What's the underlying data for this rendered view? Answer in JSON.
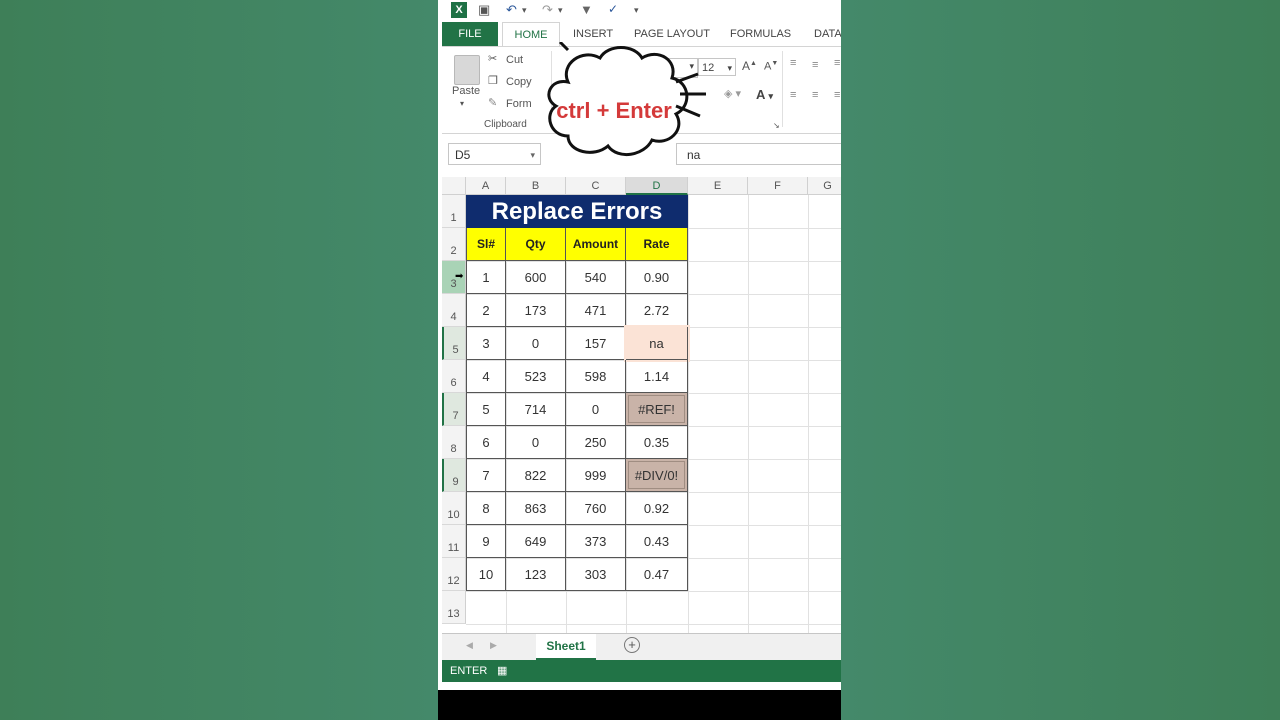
{
  "qat": {
    "undo": "↶",
    "redo": "↷"
  },
  "tabs": [
    "FILE",
    "HOME",
    "INSERT",
    "PAGE LAYOUT",
    "FORMULAS",
    "DATA"
  ],
  "clipboard": {
    "paste": "Paste",
    "cut": "Cut",
    "copy": "Copy",
    "format": "Form",
    "group": "Clipboard"
  },
  "font": {
    "size": "12"
  },
  "callout": "ctrl + Enter",
  "formula": {
    "namebox": "D5",
    "value": "na"
  },
  "columns": [
    "A",
    "B",
    "C",
    "D",
    "E",
    "F",
    "G"
  ],
  "rows": [
    "1",
    "2",
    "3",
    "4",
    "5",
    "6",
    "7",
    "8",
    "9",
    "10",
    "11",
    "12",
    "13"
  ],
  "table": {
    "title": "Replace Errors",
    "headers": [
      "Sl#",
      "Qty",
      "Amount",
      "Rate"
    ],
    "data": [
      [
        "1",
        "600",
        "540",
        "0.90"
      ],
      [
        "2",
        "173",
        "471",
        "2.72"
      ],
      [
        "3",
        "0",
        "157",
        "na"
      ],
      [
        "4",
        "523",
        "598",
        "1.14"
      ],
      [
        "5",
        "714",
        "0",
        "#REF!"
      ],
      [
        "6",
        "0",
        "250",
        "0.35"
      ],
      [
        "7",
        "822",
        "999",
        "#DIV/0!"
      ],
      [
        "8",
        "863",
        "760",
        "0.92"
      ],
      [
        "9",
        "649",
        "373",
        "0.43"
      ],
      [
        "10",
        "123",
        "303",
        "0.47"
      ]
    ]
  },
  "sheet": {
    "name": "Sheet1",
    "add": "+"
  },
  "status": {
    "mode": "ENTER"
  }
}
